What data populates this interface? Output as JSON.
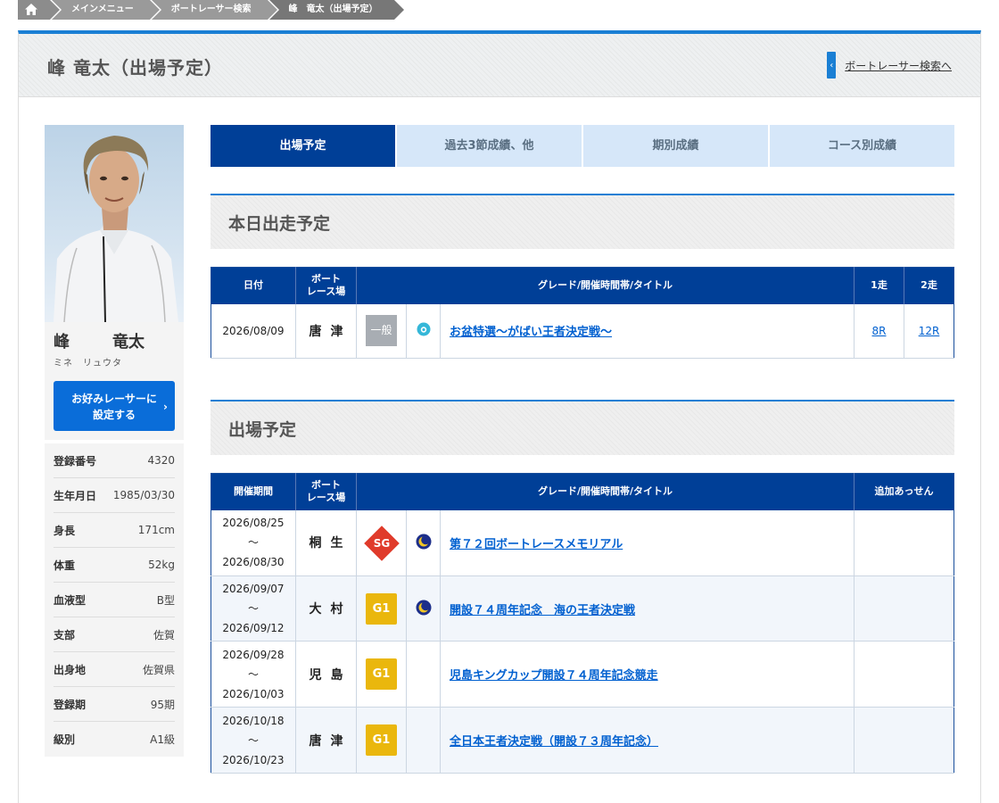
{
  "breadcrumb": {
    "items": [
      "メインメニュー",
      "ボートレーサー検索",
      "峰　竜太（出場予定）"
    ]
  },
  "header": {
    "title": "峰 竜太（出場予定）",
    "back_link": "ボートレーサー検索へ"
  },
  "profile": {
    "surname": "峰",
    "given_name": "竜太",
    "kana": "ミネ　リュウタ",
    "favorite_button_line1": "お好みレーサーに",
    "favorite_button_line2": "設定する",
    "specs": [
      {
        "label": "登録番号",
        "value": "4320"
      },
      {
        "label": "生年月日",
        "value": "1985/03/30"
      },
      {
        "label": "身長",
        "value": "171cm"
      },
      {
        "label": "体重",
        "value": "52kg"
      },
      {
        "label": "血液型",
        "value": "B型"
      },
      {
        "label": "支部",
        "value": "佐賀"
      },
      {
        "label": "出身地",
        "value": "佐賀県"
      },
      {
        "label": "登録期",
        "value": "95期"
      },
      {
        "label": "級別",
        "value": "A1級"
      }
    ]
  },
  "tabs": [
    "出場予定",
    "過去3節成績、他",
    "期別成績",
    "コース別成績"
  ],
  "today": {
    "heading": "本日出走予定",
    "headers": {
      "date": "日付",
      "venue_line1": "ボート",
      "venue_line2": "レース場",
      "title": "グレード/開催時間帯/タイトル",
      "race1": "1走",
      "race2": "2走"
    },
    "row": {
      "date": "2026/08/09",
      "venue": "唐津",
      "grade": "一般",
      "time_icon": "morning-icon",
      "title": "お盆特選〜がばい王者決定戦〜",
      "race1": "8R",
      "race2": "12R"
    }
  },
  "upcoming": {
    "heading": "出場予定",
    "headers": {
      "period": "開催期間",
      "venue_line1": "ボート",
      "venue_line2": "レース場",
      "title": "グレード/開催時間帯/タイトル",
      "extra": "追加あっせん"
    },
    "rows": [
      {
        "start": "2026/08/25",
        "sep": "〜",
        "end": "2026/08/30",
        "venue": "桐生",
        "grade": "SG",
        "time_icon": "night-icon",
        "title": "第７２回ボートレースメモリアル"
      },
      {
        "start": "2026/09/07",
        "sep": "〜",
        "end": "2026/09/12",
        "venue": "大村",
        "grade": "G1",
        "time_icon": "night-icon",
        "title": "開設７４周年記念　海の王者決定戦"
      },
      {
        "start": "2026/09/28",
        "sep": "〜",
        "end": "2026/10/03",
        "venue": "児島",
        "grade": "G1",
        "time_icon": "",
        "title": "児島キングカップ開設７４周年記念競走"
      },
      {
        "start": "2026/10/18",
        "sep": "〜",
        "end": "2026/10/23",
        "venue": "唐津",
        "grade": "G1",
        "time_icon": "",
        "title": "全日本王者決定戦（開設７３周年記念）"
      }
    ]
  },
  "colors": {
    "accent": "#1a7fd4",
    "tab_active": "#003f97",
    "tab_inactive": "#d6e7f9",
    "g1": "#eab70d",
    "sg": "#e03b2b"
  }
}
